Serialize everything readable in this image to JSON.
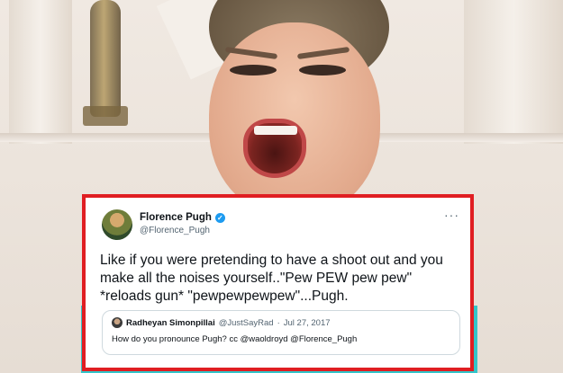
{
  "tweet": {
    "display_name": "Florence Pugh",
    "handle": "@Florence_Pugh",
    "verified_glyph": "✓",
    "more_glyph": "···",
    "text": "Like if you were pretending to have a shoot out and you make all the noises yourself..\"Pew PEW pew pew\" *reloads gun* \"pewpewpewpew\"...Pugh."
  },
  "quote": {
    "display_name": "Radheyan Simonpillai",
    "handle": "@JustSayRad",
    "separator": "·",
    "date": "Jul 27, 2017",
    "text": "How do you pronounce Pugh? cc @waoldroyd @Florence_Pugh"
  },
  "colors": {
    "frame_border": "#e01e22",
    "verified": "#1d9bf0",
    "text_primary": "#0f1419",
    "text_secondary": "#536471"
  }
}
